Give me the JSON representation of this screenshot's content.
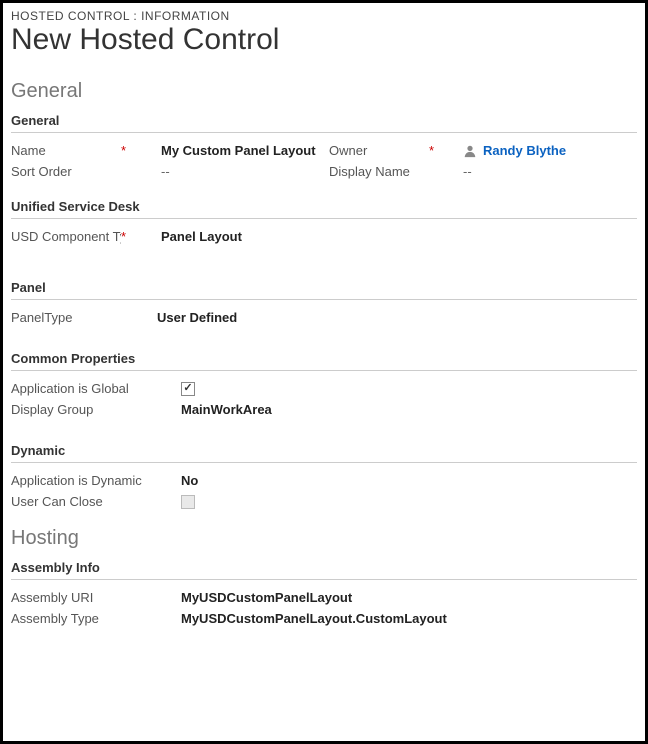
{
  "breadcrumb": "HOSTED CONTROL : INFORMATION",
  "page_title": "New Hosted Control",
  "sections": {
    "general": {
      "title": "General",
      "sub_general": {
        "title": "General",
        "name_label": "Name",
        "name_value": "My Custom Panel Layout",
        "owner_label": "Owner",
        "owner_value": "Randy Blythe",
        "sort_order_label": "Sort Order",
        "sort_order_value": "--",
        "display_name_label": "Display Name",
        "display_name_value": "--"
      },
      "usd": {
        "title": "Unified Service Desk",
        "component_label": "USD Component Type",
        "component_value": "Panel Layout"
      },
      "panel": {
        "title": "Panel",
        "panel_type_label": "PanelType",
        "panel_type_value": "User Defined"
      },
      "common": {
        "title": "Common Properties",
        "app_global_label": "Application is Global",
        "display_group_label": "Display Group",
        "display_group_value": "MainWorkArea"
      },
      "dynamic": {
        "title": "Dynamic",
        "app_dynamic_label": "Application is Dynamic",
        "app_dynamic_value": "No",
        "user_close_label": "User Can Close"
      }
    },
    "hosting": {
      "title": "Hosting",
      "assembly": {
        "title": "Assembly Info",
        "uri_label": "Assembly URI",
        "uri_value": "MyUSDCustomPanelLayout",
        "type_label": "Assembly Type",
        "type_value": "MyUSDCustomPanelLayout.CustomLayout"
      }
    }
  },
  "required_marker": "*"
}
